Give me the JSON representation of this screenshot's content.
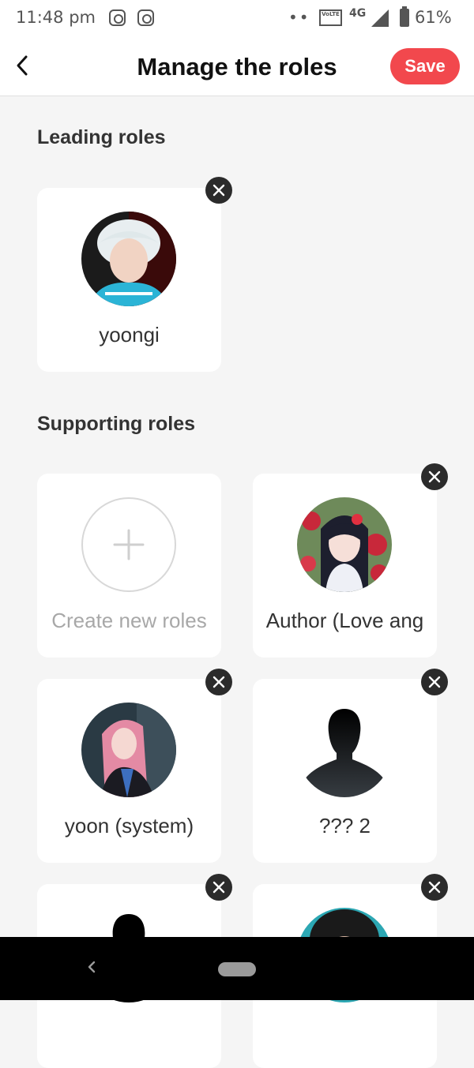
{
  "status_bar": {
    "time": "11:48 pm",
    "network": "4G",
    "volte": "VoLTE",
    "battery": "61%"
  },
  "header": {
    "title": "Manage the roles",
    "save_label": "Save"
  },
  "leading_section": {
    "title": "Leading roles",
    "roles": [
      {
        "name": "yoongi",
        "avatar": "photo"
      }
    ]
  },
  "supporting_section": {
    "title": "Supporting roles",
    "create_label": "Create new roles",
    "roles": [
      {
        "name": "Author (Love ang",
        "avatar": "anime-girl"
      },
      {
        "name": "yoon (system)",
        "avatar": "anime-pink-hair"
      },
      {
        "name": "??? 2",
        "avatar": "silhouette"
      },
      {
        "name": "",
        "avatar": "silhouette"
      },
      {
        "name": "",
        "avatar": "photo"
      }
    ]
  },
  "colors": {
    "accent": "#f2484d",
    "background": "#f5f5f5",
    "card": "#ffffff",
    "close_button": "#2b2b2b"
  }
}
